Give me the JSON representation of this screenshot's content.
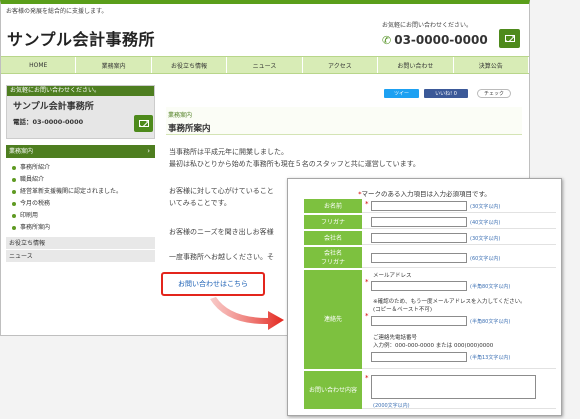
{
  "site": {
    "tagline": "お客様の発展を総合的に支援します。",
    "logo": "サンプル会計事務所",
    "header_contact_label": "お気軽にお問い合わせください。",
    "header_phone": "03-0000-0000"
  },
  "nav": [
    "HOME",
    "業務案内",
    "お役立ち情報",
    "ニュース",
    "アクセス",
    "お問い合わせ",
    "決算公告"
  ],
  "sidebar": {
    "contact_bar": "お気軽にお問い合わせください。",
    "office_name": "サンプル会計事務所",
    "phone": "電話：03-0000-0000",
    "menu_head": "業務案内",
    "menu_items": [
      "事務所紹介",
      "職員紹介",
      "経営革新支援機関に認定されました。",
      "今月の税務",
      "印刷用",
      "事務所案内"
    ],
    "links": [
      "お役立ち情報",
      "ニュース"
    ]
  },
  "social": {
    "tweet": "ツイー",
    "like": "いいね! 0",
    "check": "チェック"
  },
  "main": {
    "category": "業務案内",
    "title": "事務所案内",
    "para1_line1": "当事務所は平成元年に開業しました。",
    "para1_line2": "最初は私ひとりから始めた事務所も現在５名のスタッフと共に運営しています。",
    "para2_line1": "お客様に対して心がけていること",
    "para2_line2": "いてみることです。",
    "para3_line1": "お客様のニーズを聞き出しお客様",
    "para4_line1": "一度事務所へお越しください。そ",
    "cta": "お問い合わせはこちら"
  },
  "form": {
    "note_prefix": "*",
    "note_text": "マークのある入力項目は入力必須項目です。",
    "rows": {
      "name": {
        "label": "お名前",
        "hint": "(30文字以内)"
      },
      "furigana": {
        "label": "フリガナ",
        "hint": "(40文字以内)"
      },
      "company": {
        "label": "会社名",
        "hint": "(30文字以内)"
      },
      "company_furigana": {
        "label1": "会社名",
        "label2": "フリガナ",
        "hint": "(60文字以内)"
      },
      "contact": {
        "label": "連絡先",
        "email_label": "メールアドレス",
        "email_hint": "(半角80文字以内)",
        "confirm_text1": "※確認のため、もう一度メールアドレスを入力してください。",
        "confirm_text2": "(コピー＆ペースト不可)",
        "confirm_hint": "(半角80文字以内)",
        "tel_label": "ご連絡先電話番号",
        "tel_format": "入力例：000-000-0000 または 000(000)0000",
        "tel_hint": "(半角13文字以内)"
      },
      "inquiry": {
        "label": "お問い合わせ内容",
        "hint": "(2000文字以内)"
      }
    }
  },
  "colors": {
    "green": "#7dc13f",
    "dark_green": "#4e7e20",
    "red": "#e3251c",
    "link": "#1a5fb4"
  }
}
